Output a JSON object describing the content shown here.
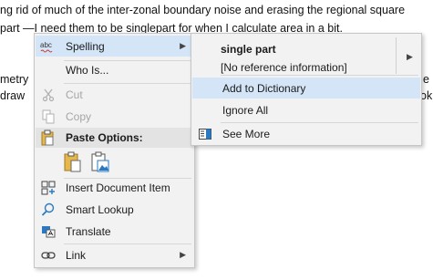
{
  "document": {
    "line1": "ng rid of much of the inter-zonal boundary noise and erasing the regional square",
    "line2_before": " part —I need them to be ",
    "line2_misspelled": "singlepart",
    "line2_after": " for when I calculate area in a bit.",
    "line3_left": "metry",
    "line3_right": "e",
    "line4_left": " draw",
    "line4_right": "ok"
  },
  "context_menu": {
    "spelling": {
      "icon_text": "abc",
      "label": "Spelling"
    },
    "who_is": "Who Is...",
    "cut": "Cut",
    "copy": "Copy",
    "paste_options": "Paste Options:",
    "insert_document_item": "Insert Document Item",
    "smart_lookup": "Smart Lookup",
    "translate": "Translate",
    "link": "Link"
  },
  "spelling_submenu": {
    "suggestion": "single part",
    "suggestion_info": "[No reference information]",
    "add_to_dictionary": "Add to Dictionary",
    "ignore_all": "Ignore All",
    "see_more": "See More"
  },
  "colors": {
    "highlight": "#d3e5f6",
    "menu_bg": "#f2f2f2",
    "disabled_text": "#a6a6a6",
    "spell_underline": "#d0332f",
    "accent_blue": "#2b79c2"
  }
}
